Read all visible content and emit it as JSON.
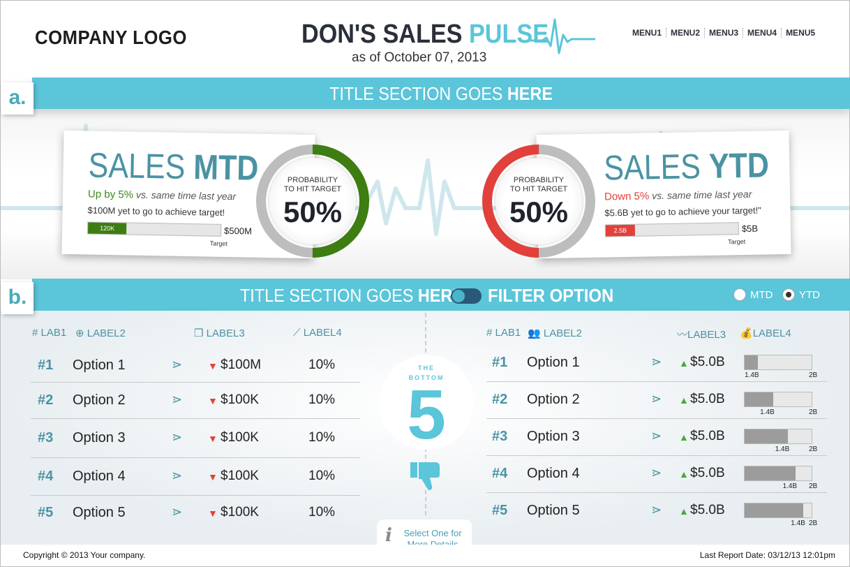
{
  "header": {
    "logo": "COMPANY LOGO",
    "brand_main": "DON'S SALES ",
    "brand_accent": "PULSE",
    "as_of": "as of October 07, 2013",
    "menu": [
      "MENU1",
      "MENU2",
      "MENU3",
      "MENU4",
      "MENU5"
    ]
  },
  "section_a": {
    "tag": "a.",
    "title_prefix": "TITLE SECTION GOES ",
    "title_bold": "HERE"
  },
  "mtd": {
    "title_prefix": "SALES ",
    "title_bold": "MTD",
    "delta_prefix": "Up by ",
    "delta_value": "5%",
    "delta_suffix": " vs. same time last year",
    "to_go": "$100M yet to go to achieve target!",
    "bar_label": "120K",
    "bar_fraction": 0.29,
    "bar_color": "#3d7d12",
    "bar_max": "$500M",
    "target_label": "Target",
    "gauge_label_1": "PROBABILITY",
    "gauge_label_2": "TO HIT TARGET",
    "gauge_value": "50%",
    "gauge_fraction": 0.5,
    "gauge_color": "#3d7d12",
    "delta_color": "#3d8a1f"
  },
  "ytd": {
    "title_prefix": "SALES ",
    "title_bold": "YTD",
    "delta_prefix": "Down ",
    "delta_value": "5%",
    "delta_suffix": " vs. same time last year",
    "to_go": "$5.6B yet to go to achieve your target!\"",
    "bar_label": "2.5B",
    "bar_fraction": 0.22,
    "bar_color": "#e2403a",
    "bar_max": "$5B",
    "target_label": "Target",
    "gauge_label_1": "PROBABILITY",
    "gauge_label_2": "TO HIT TARGET",
    "gauge_value": "50%",
    "gauge_fraction": 0.5,
    "gauge_color": "#e2403a",
    "delta_color": "#e2403a"
  },
  "section_b": {
    "tag": "b.",
    "title_prefix": "TITLE SECTION GOES ",
    "title_bold": "HERE",
    "filter_label": "FILTER OPTION",
    "radio_mtd": "MTD",
    "radio_ytd": "YTD",
    "selected": "YTD"
  },
  "left_table": {
    "headers": [
      "# LAB1",
      "LABEL2",
      "LABEL3",
      "LABEL4"
    ],
    "rows": [
      {
        "rank": "#1",
        "option": "Option 1",
        "amount": "$100M",
        "pct": "10%"
      },
      {
        "rank": "#2",
        "option": "Option 2",
        "amount": "$100K",
        "pct": "10%"
      },
      {
        "rank": "#3",
        "option": "Option 3",
        "amount": "$100K",
        "pct": "10%"
      },
      {
        "rank": "#4",
        "option": "Option 4",
        "amount": "$100K",
        "pct": "10%"
      },
      {
        "rank": "#5",
        "option": "Option 5",
        "amount": "$100K",
        "pct": "10%"
      }
    ]
  },
  "right_table": {
    "headers": [
      "# LAB1",
      "LABEL2",
      "LABEL3",
      "LABEL4"
    ],
    "rows": [
      {
        "rank": "#1",
        "option": "Option 1",
        "amount": "$5.0B",
        "fill": 0.2,
        "mark": "1.4B",
        "max": "2B"
      },
      {
        "rank": "#2",
        "option": "Option 2",
        "amount": "$5.0B",
        "fill": 0.43,
        "mark": "1.4B",
        "max": "2B"
      },
      {
        "rank": "#3",
        "option": "Option 3",
        "amount": "$5.0B",
        "fill": 0.65,
        "mark": "1.4B",
        "max": "2B"
      },
      {
        "rank": "#4",
        "option": "Option 4",
        "amount": "$5.0B",
        "fill": 0.76,
        "mark": "1.4B",
        "max": "2B"
      },
      {
        "rank": "#5",
        "option": "Option 5",
        "amount": "$5.0B",
        "fill": 0.88,
        "mark": "1.4B",
        "max": "2B"
      }
    ]
  },
  "bottom5": {
    "line1": "THE",
    "line2": "BOTTOM",
    "number": "5"
  },
  "details": {
    "icon": "i",
    "line1": "Select One for",
    "line2": "More Details"
  },
  "footer": {
    "copyright": "Copyright © 2013 Your company.",
    "last_report": "Last Report Date: 03/12/13 12:01pm"
  }
}
